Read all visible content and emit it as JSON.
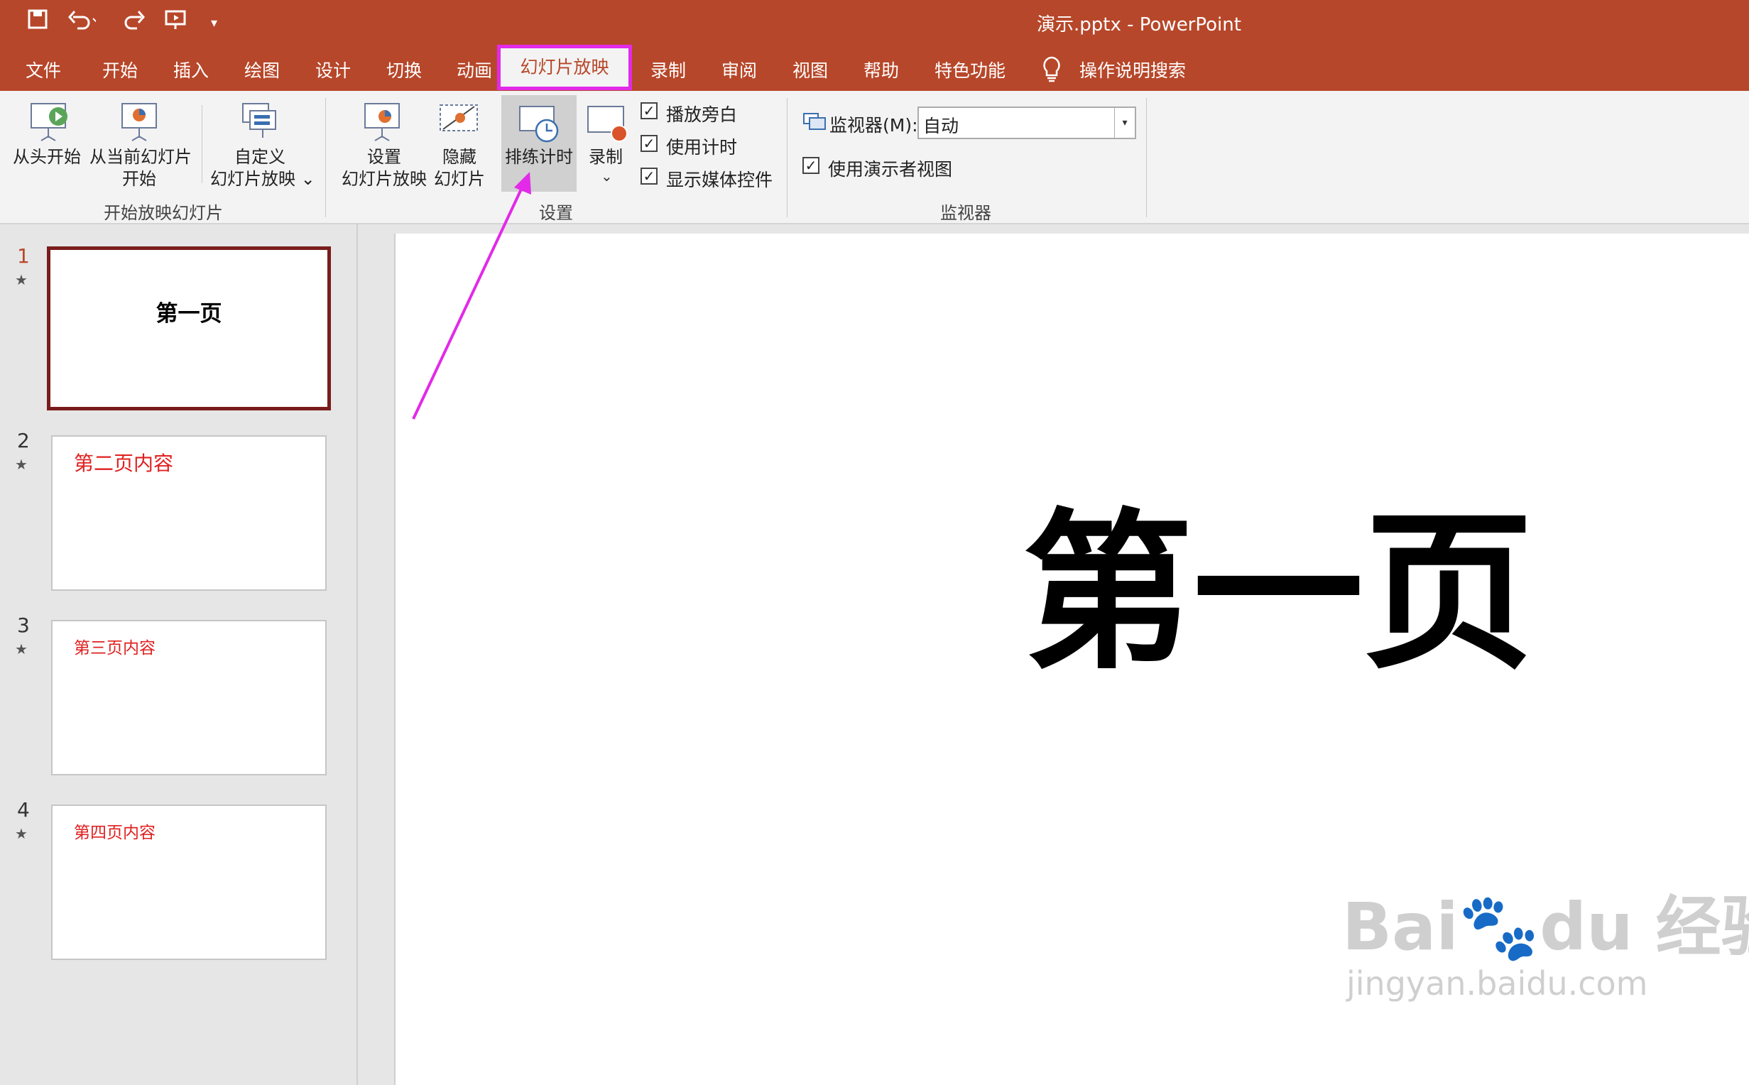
{
  "window": {
    "title": "演示.pptx  -  PowerPoint"
  },
  "quick_access": [
    {
      "icon": "save-icon"
    },
    {
      "icon": "undo-icon"
    },
    {
      "icon": "redo-icon"
    },
    {
      "icon": "present-from-start-icon"
    },
    {
      "icon": "customize-toolbar-icon"
    }
  ],
  "tabs": [
    "文件",
    "开始",
    "插入",
    "绘图",
    "设计",
    "切换",
    "动画",
    "幻灯片放映",
    "录制",
    "审阅",
    "视图",
    "帮助",
    "特色功能"
  ],
  "active_tab": "幻灯片放映",
  "tell_me": "操作说明搜索",
  "ribbon": {
    "start_group": {
      "label": "开始放映幻灯片",
      "from_beginning": "从头开始",
      "from_current_line1": "从当前幻灯片",
      "from_current_line2": "开始",
      "custom_line1": "自定义",
      "custom_line2": "幻灯片放映 ⌄"
    },
    "setup_group": {
      "label": "设置",
      "setup_line1": "设置",
      "setup_line2": "幻灯片放映",
      "hide_line1": "隐藏",
      "hide_line2": "幻灯片",
      "rehearse": "排练计时",
      "record": "录制",
      "record_arrow": "⌄",
      "checkboxes": [
        {
          "label": "播放旁白",
          "checked": true
        },
        {
          "label": "使用计时",
          "checked": true
        },
        {
          "label": "显示媒体控件",
          "checked": true
        }
      ]
    },
    "monitors_group": {
      "label": "监视器",
      "monitor_label": "监视器(M):",
      "monitor_value": "自动",
      "presenter_view_label": "使用演示者视图",
      "presenter_view_checked": true
    }
  },
  "slides": [
    {
      "number": "1",
      "text": "第一页",
      "selected": true
    },
    {
      "number": "2",
      "text": "第二页内容",
      "selected": false
    },
    {
      "number": "3",
      "text": "第三页内容",
      "selected": false
    },
    {
      "number": "4",
      "text": "第四页内容",
      "selected": false
    }
  ],
  "current_slide": {
    "title": "第一页"
  },
  "colors": {
    "accent": "#b7472a",
    "highlight": "#e22ae8",
    "thumb_text": "#e02020"
  },
  "watermark": {
    "line1": "Bai🐾du 经验",
    "line2": "jingyan.baidu.com"
  }
}
